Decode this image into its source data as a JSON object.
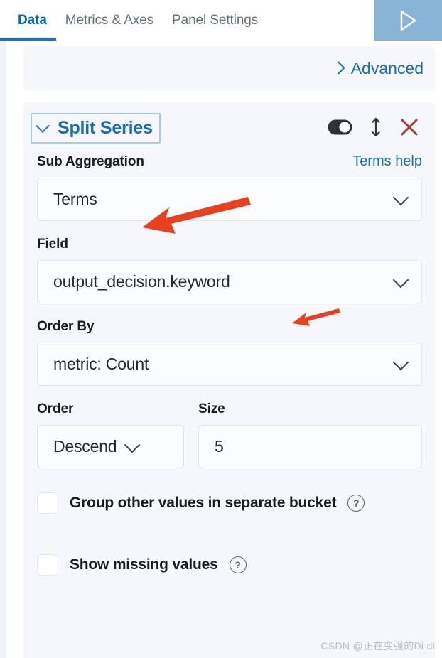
{
  "tabs": [
    {
      "label": "Data",
      "active": true
    },
    {
      "label": "Metrics & Axes",
      "active": false
    },
    {
      "label": "Panel Settings",
      "active": false
    }
  ],
  "run_button": {
    "name": "update-button",
    "icon": "play-triangle-icon"
  },
  "advanced": {
    "label": "Advanced",
    "chevron": "chevron-right-icon"
  },
  "split_series": {
    "title": "Split Series",
    "collapse_icon": "chevron-down-icon",
    "toggle_icon": "toggle-switch-on-icon",
    "sort_icon": "sort-updown-icon",
    "remove_icon": "close-x-icon"
  },
  "fields": {
    "sub_aggregation": {
      "label": "Sub Aggregation",
      "help_label": "Terms help",
      "value": "Terms"
    },
    "field": {
      "label": "Field",
      "value": "output_decision.keyword"
    },
    "order_by": {
      "label": "Order By",
      "value": "metric: Count"
    },
    "order": {
      "label": "Order",
      "value": "Descend"
    },
    "size": {
      "label": "Size",
      "value": "5",
      "placeholder": "Size"
    }
  },
  "checkboxes": [
    {
      "label": "Group other values in separate bucket",
      "checked": false,
      "help": "?"
    },
    {
      "label": "Show missing values",
      "checked": false,
      "help": "?"
    }
  ],
  "watermark": "CSDN @正在变强的Di di",
  "colors": {
    "accent_blue": "#1a6cb5",
    "tab_underline": "#1c6fba",
    "panel_bg": "#f5f7fa",
    "run_button_bg": "#8ab4d6",
    "remove_red": "#a63a2c",
    "annotation_red": "#e8401f",
    "toggle_on": "#2c333f"
  }
}
